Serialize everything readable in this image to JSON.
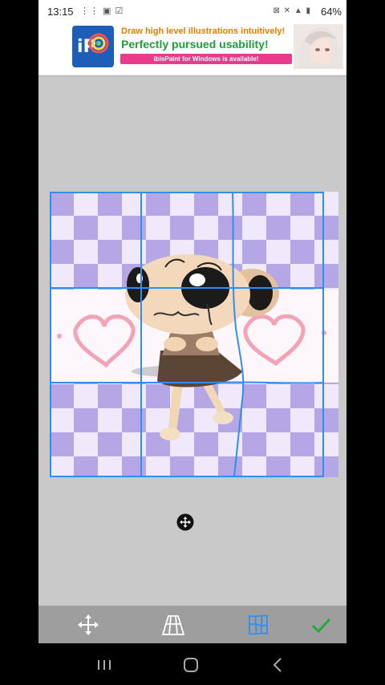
{
  "status": {
    "time": "13:15",
    "left_icons": "⋮⋮ ▣ ☑",
    "right_icons": "⊠ ✕ ▲ ▮",
    "battery": "64%"
  },
  "ad": {
    "line1": "Draw high level illustrations intuitively!",
    "line2": "Perfectly pursued usability!",
    "line3": "ibisPaint for Windows is available!",
    "logo": "iP"
  },
  "toolbar": {
    "tools": [
      {
        "name": "move-tool",
        "icon": "move-arrows-icon"
      },
      {
        "name": "perspective-tool",
        "icon": "perspective-grid-icon"
      },
      {
        "name": "mesh-tool",
        "icon": "mesh-warp-icon",
        "active": true
      },
      {
        "name": "confirm",
        "icon": "checkmark-icon"
      }
    ]
  },
  "colors": {
    "accent_blue": "#2f8ff0",
    "confirm_green": "#23a83a",
    "checker_purple": "#b5a6e6",
    "checker_light": "#efe9fb",
    "heart_pink": "#f4a3b4"
  }
}
